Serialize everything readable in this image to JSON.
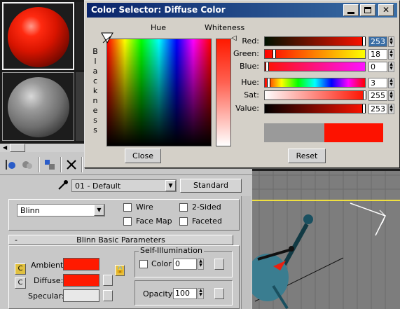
{
  "dialog": {
    "title": "Color Selector: Diffuse Color",
    "hue_label": "Hue",
    "whiteness_label": "Whiteness",
    "blackness_label": "Blackness",
    "close_label": "Close",
    "reset_label": "Reset",
    "channels": [
      {
        "label": "Red:",
        "value": "253"
      },
      {
        "label": "Green:",
        "value": "18"
      },
      {
        "label": "Blue:",
        "value": "0"
      },
      {
        "label": "Hue:",
        "value": "3"
      },
      {
        "label": "Sat:",
        "value": "255"
      },
      {
        "label": "Value:",
        "value": "253"
      }
    ],
    "old_color": "#9a9a9a",
    "new_color": "#fd1200"
  },
  "material_editor": {
    "material_name": "01 - Default",
    "material_type": "Standard",
    "shader": "Blinn",
    "options": {
      "wire": "Wire",
      "two_sided": "2-Sided",
      "face_map": "Face Map",
      "faceted": "Faceted"
    },
    "rollout_title": "Blinn Basic Parameters",
    "rollout_toggle": "-",
    "ambient_label": "Ambient:",
    "diffuse_label": "Diffuse:",
    "specular_label": "Specular:",
    "self_illum_title": "Self-Illumination",
    "self_illum_color_label": "Color",
    "self_illum_value": "0",
    "opacity_label": "Opacity:",
    "opacity_value": "100",
    "ambient_color": "#ff1a00",
    "diffuse_color": "#ff1a00",
    "specular_color": "#e8e8e8"
  }
}
